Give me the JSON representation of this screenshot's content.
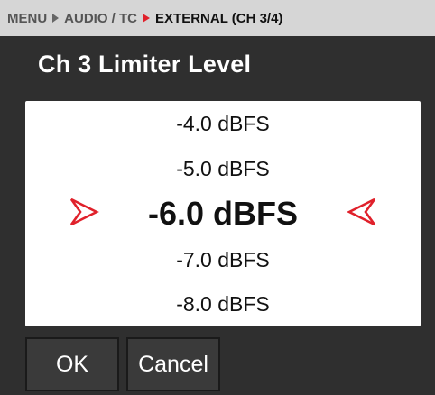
{
  "breadcrumb": {
    "item1": "MENU",
    "item2": "AUDIO / TC",
    "current": "EXTERNAL (CH 3/4)"
  },
  "title": "Ch 3 Limiter Level",
  "picker": {
    "options": [
      "-4.0 dBFS",
      "-5.0 dBFS",
      "-6.0 dBFS",
      "-7.0 dBFS",
      "-8.0 dBFS"
    ],
    "selected_index": 2
  },
  "buttons": {
    "ok_label": "OK",
    "cancel_label": "Cancel"
  },
  "colors": {
    "accent": "#e0212b",
    "header_bg": "#d6d6d6",
    "panel_bg": "#2f2f2f"
  }
}
